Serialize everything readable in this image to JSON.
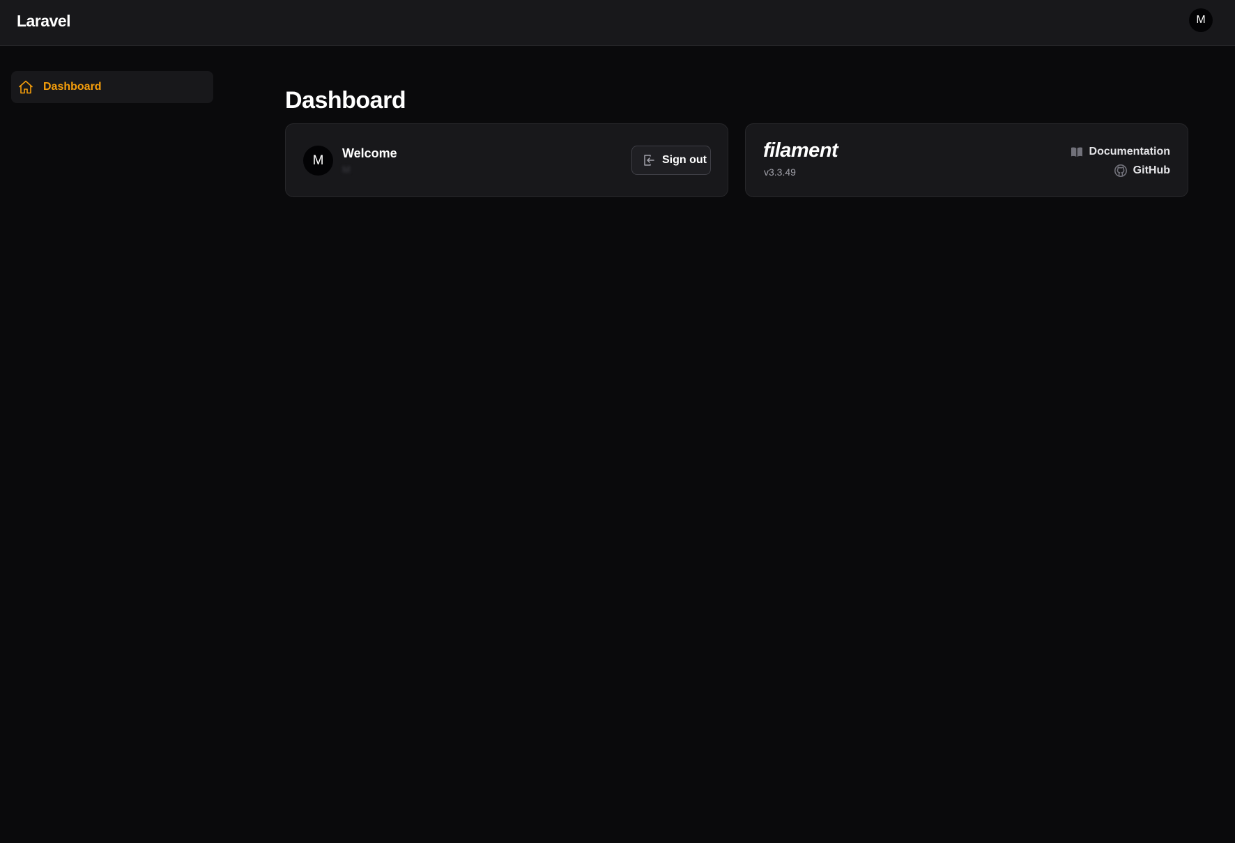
{
  "app": {
    "brand": "Laravel",
    "user_initial": "M"
  },
  "sidebar": {
    "items": [
      {
        "label": "Dashboard",
        "icon": "home-icon",
        "active": true
      }
    ]
  },
  "main": {
    "title": "Dashboard",
    "welcome_card": {
      "avatar_initial": "M",
      "title": "Welcome",
      "user_name": "M",
      "signout_label": "Sign out"
    },
    "filament_card": {
      "logo": "filament",
      "version": "v3.3.49",
      "docs_label": "Documentation",
      "github_label": "GitHub"
    }
  },
  "colors": {
    "accent": "#f59e0b",
    "background": "#0a0a0c",
    "surface": "#18181b",
    "border": "#27272a"
  }
}
